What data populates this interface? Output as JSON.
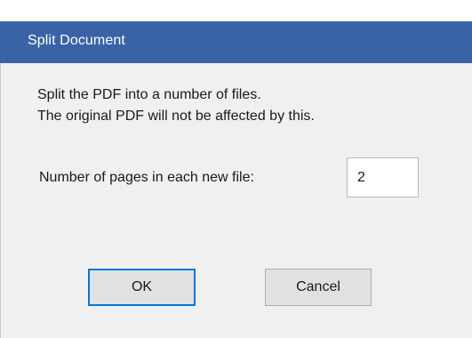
{
  "window": {
    "title": "Split Document"
  },
  "description": {
    "line1": "Split the PDF into a number of files.",
    "line2": "The original PDF will not be affected by this."
  },
  "pages_field": {
    "label": "Number of pages in each new file:",
    "value": "2"
  },
  "buttons": {
    "ok_label": "OK",
    "cancel_label": "Cancel"
  },
  "colors": {
    "titlebar": "#3a63a7",
    "dialog_background": "#f0f0f0",
    "default_button_border": "#0078d7"
  }
}
